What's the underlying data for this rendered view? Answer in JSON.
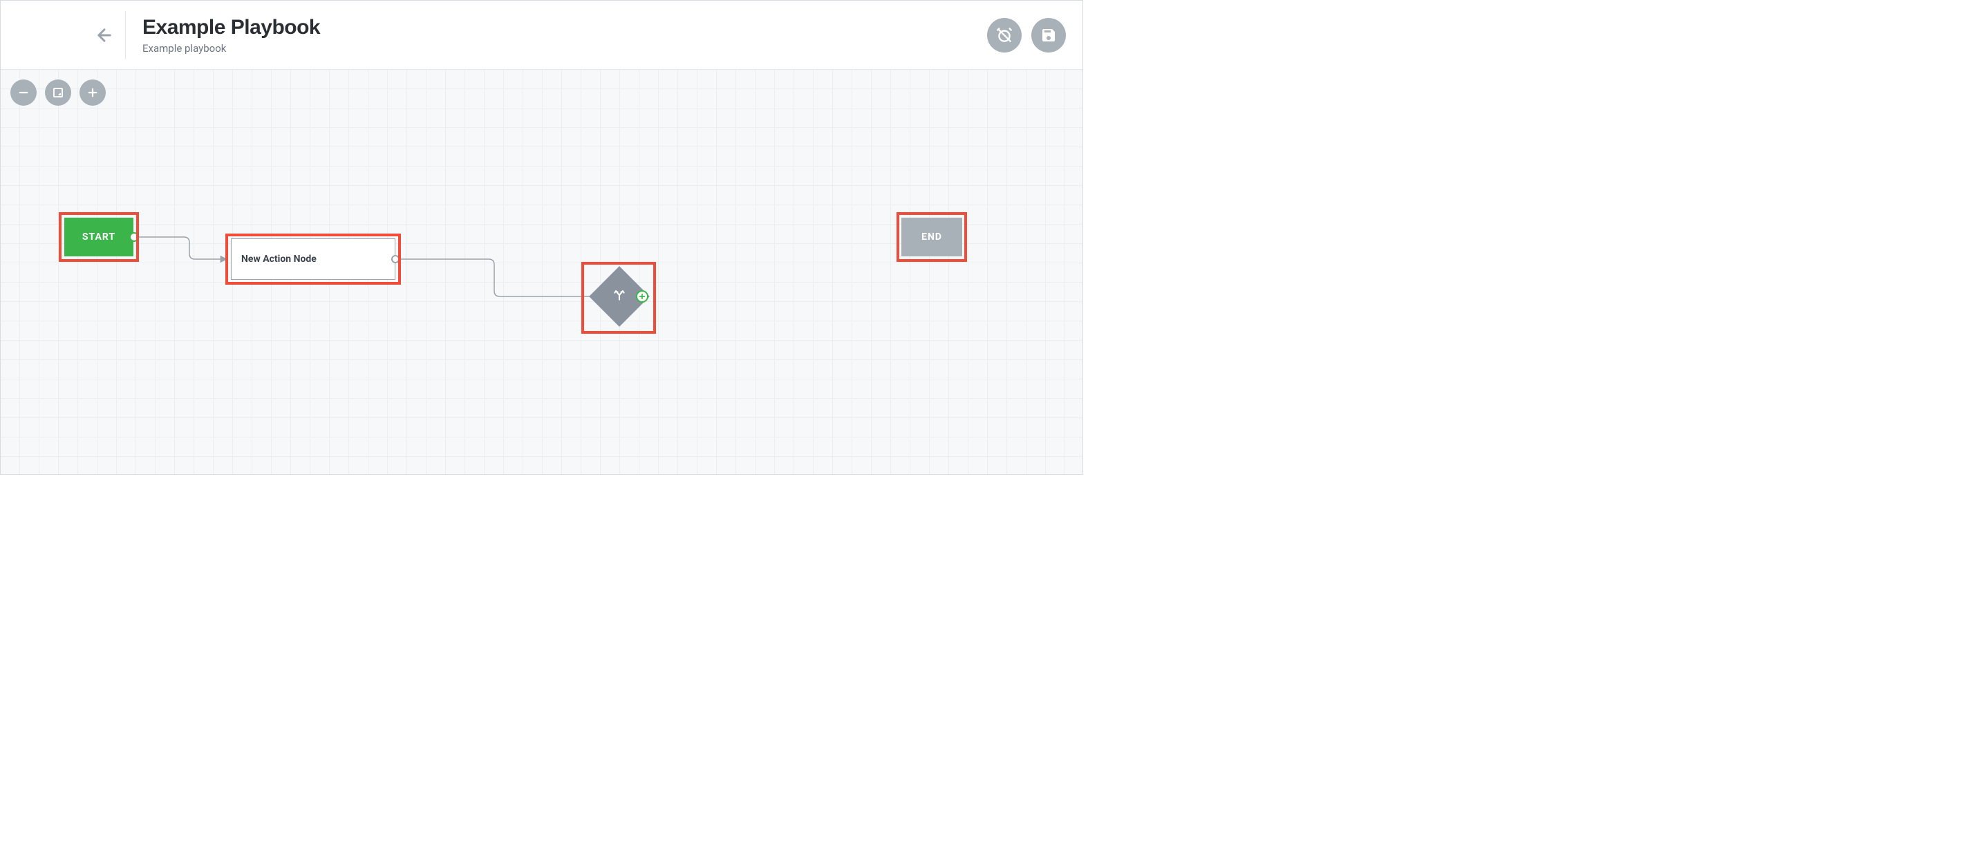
{
  "header": {
    "title": "Example Playbook",
    "subtitle": "Example playbook"
  },
  "nodes": {
    "start": {
      "label": "START"
    },
    "action": {
      "label": "New Action Node"
    },
    "end": {
      "label": "END"
    }
  },
  "icons": {
    "back": "arrow-left",
    "alarm_off": "alarm-off",
    "save": "save",
    "zoom_out": "minus",
    "fit": "fit-screen",
    "zoom_in": "plus",
    "branch": "split-arrows",
    "add": "plus"
  }
}
